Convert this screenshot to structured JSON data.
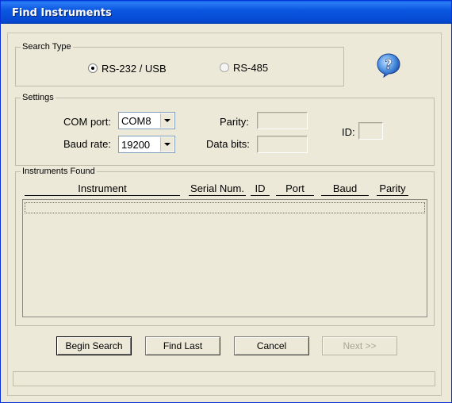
{
  "window": {
    "title": "Find Instruments"
  },
  "search_type": {
    "legend": "Search Type",
    "options": [
      {
        "label": "RS-232 / USB",
        "selected": true
      },
      {
        "label": "RS-485",
        "selected": false
      }
    ]
  },
  "help": {
    "icon": "question-mark-help-icon"
  },
  "settings": {
    "legend": "Settings",
    "com_port": {
      "label": "COM port:",
      "value": "COM8"
    },
    "baud_rate": {
      "label": "Baud rate:",
      "value": "19200"
    },
    "parity": {
      "label": "Parity:",
      "value": ""
    },
    "data_bits": {
      "label": "Data bits:",
      "value": ""
    },
    "id": {
      "label": "ID:",
      "value": ""
    }
  },
  "instruments_found": {
    "legend": "Instruments Found",
    "columns": [
      "Instrument",
      "Serial Num.",
      "ID",
      "Port",
      "Baud",
      "Parity"
    ],
    "rows": []
  },
  "buttons": {
    "begin_search": "Begin Search",
    "find_last": "Find Last",
    "cancel": "Cancel",
    "next": "Next >>"
  },
  "status_bar": {
    "text": ""
  },
  "colors": {
    "titlebar": "#0b57e0",
    "face": "#ece9d8",
    "disabled_text": "#a8a596"
  }
}
